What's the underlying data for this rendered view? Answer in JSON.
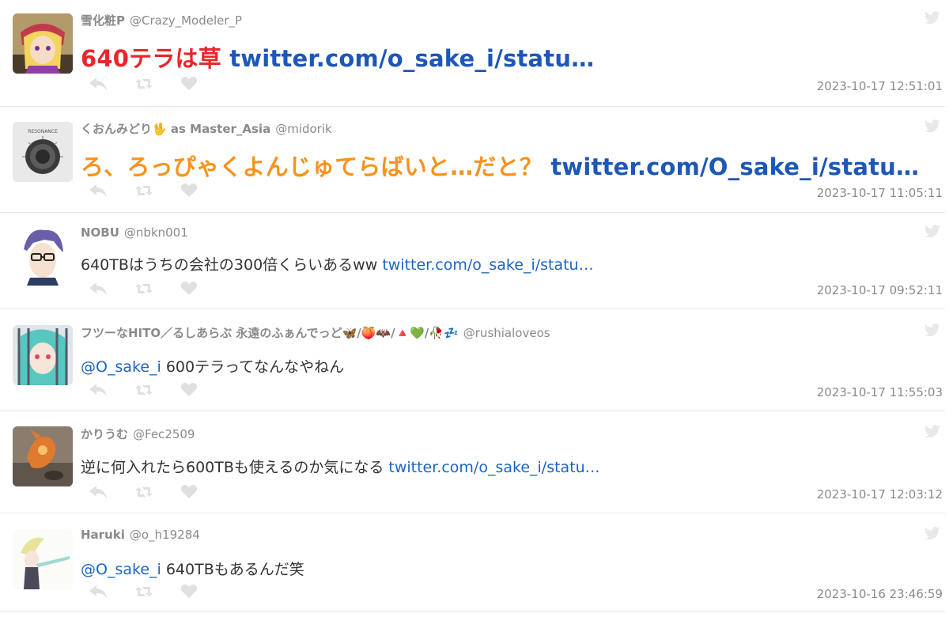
{
  "tweets": [
    {
      "display_name": "雪化粧P",
      "handle": "@Crazy_Modeler_P",
      "text": "640テラは草",
      "link": "twitter.com/o_sake_i/statu…",
      "timestamp": "2023-10-17 12:51:01",
      "style": "big-red"
    },
    {
      "display_name": "くおんみどり🖖 as Master_Asia",
      "handle": "@midorik",
      "text": "ろ、ろっぴゃくよんじゅてらばいと…だと？",
      "link": "twitter.com/O_sake_i/statu…",
      "timestamp": "2023-10-17 11:05:11",
      "style": "big-orange",
      "avatar_label": "RESONANCE"
    },
    {
      "display_name": "NOBU",
      "handle": "@nbkn001",
      "text": "640TBはうちの会社の300倍くらいあるww",
      "link": "twitter.com/o_sake_i/statu…",
      "timestamp": "2023-10-17 09:52:11",
      "style": "normal"
    },
    {
      "display_name": "フツーなHITO／るしあらぶ 永遠のふぁんでっど🦋/🍑🦇/🔺💚/🥀💤",
      "handle": "@rushialoveos",
      "mention": "@O_sake_i",
      "text": "600テラってなんなやねん",
      "timestamp": "2023-10-17 11:55:03",
      "style": "normal"
    },
    {
      "display_name": "かりうむ",
      "handle": "@Fec2509",
      "text": "逆に何入れたら600TBも使えるのか気になる",
      "link": "twitter.com/o_sake_i/statu…",
      "timestamp": "2023-10-17 12:03:12",
      "style": "normal"
    },
    {
      "display_name": "Haruki",
      "handle": "@o_h19284",
      "mention": "@O_sake_i",
      "text": "640TBもあるんだ笑",
      "timestamp": "2023-10-16 23:46:59",
      "style": "normal"
    }
  ],
  "colors": {
    "accent_red": "#e8272b",
    "accent_orange": "#f7931d",
    "link_blue": "#1d63c4",
    "meta_gray": "#8a8a8a",
    "action_icon": "#e0e0e0"
  },
  "icons": {
    "reply": "reply-icon",
    "retweet": "retweet-icon",
    "like": "heart-icon",
    "brand": "twitter-bird-icon"
  }
}
